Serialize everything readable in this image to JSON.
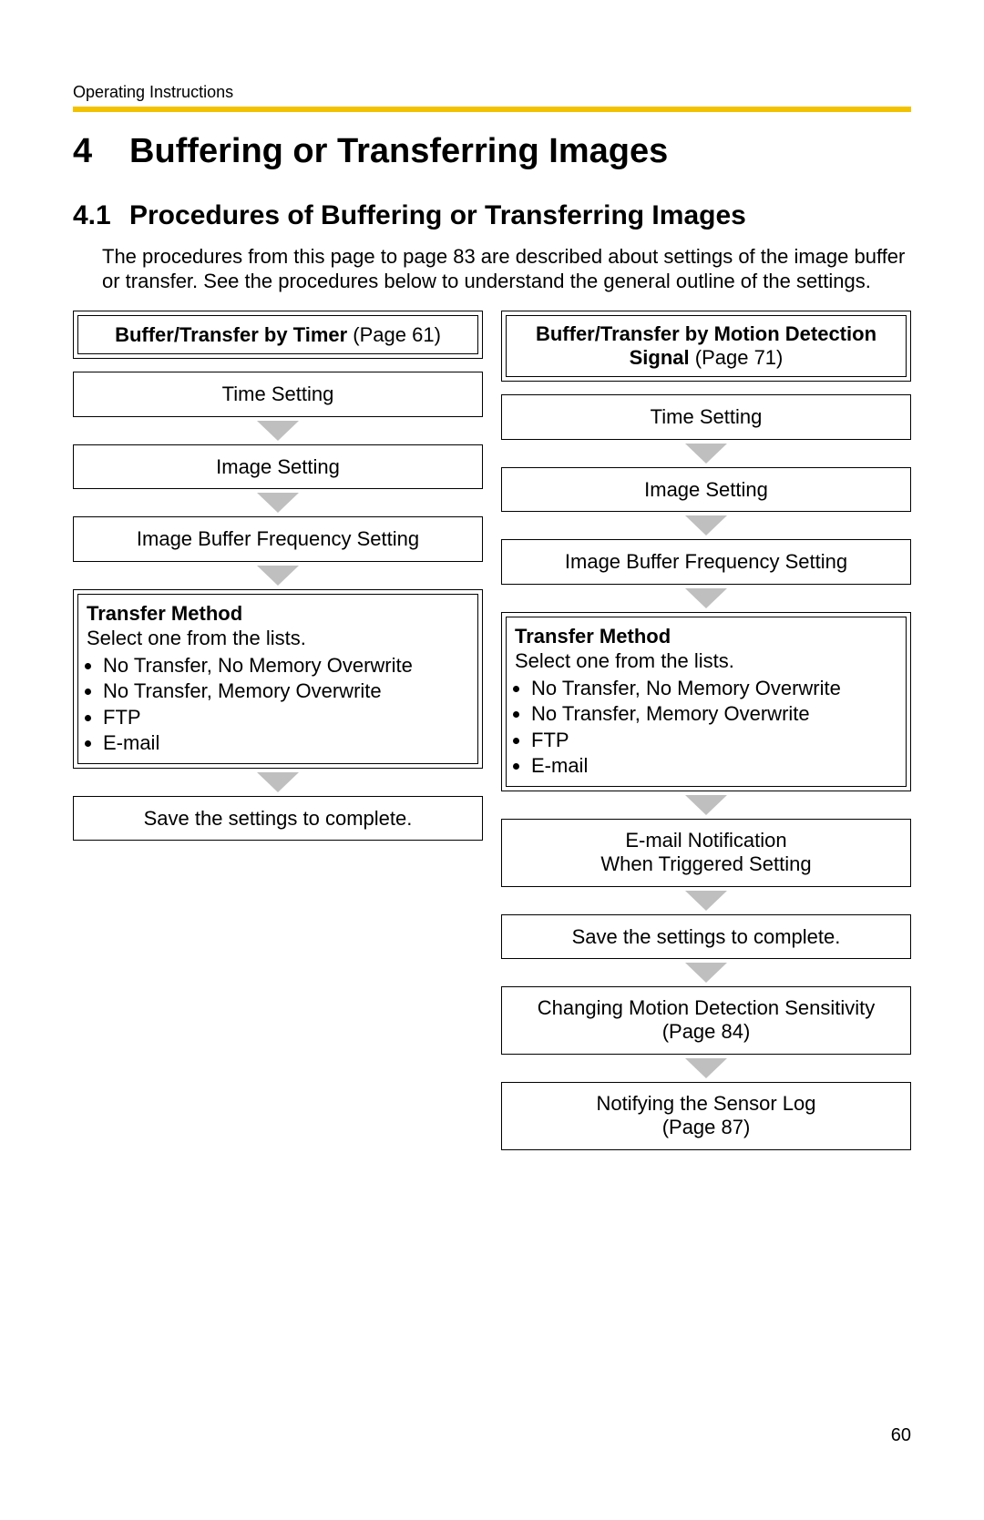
{
  "doc_header": "Operating Instructions",
  "section_number": "4",
  "section_title": "Buffering or Transferring Images",
  "subsection_number": "4.1",
  "subsection_title": "Procedures of Buffering or Transferring Images",
  "intro_text": "The procedures from this page to page 83 are described about settings of the image buffer or transfer. See the procedures below to understand the general outline of the settings.",
  "left_column": {
    "header_bold": "Buffer/Transfer by Timer",
    "header_page": " (Page 61)",
    "step1": "Time Setting",
    "step2": "Image Setting",
    "step3": "Image Buffer Frequency Setting",
    "transfer_method_title": "Transfer Method",
    "transfer_method_sub": "Select one from the lists.",
    "transfer_options": {
      "0": "No Transfer, No Memory Overwrite",
      "1": "No Transfer, Memory Overwrite",
      "2": "FTP",
      "3": "E-mail"
    },
    "step5": "Save the settings to complete."
  },
  "right_column": {
    "header_bold": "Buffer/Transfer by Motion Detection Signal",
    "header_page": " (Page 71)",
    "step1": "Time Setting",
    "step2": "Image Setting",
    "step3": "Image Buffer Frequency Setting",
    "transfer_method_title": "Transfer Method",
    "transfer_method_sub": "Select one from the lists.",
    "transfer_options": {
      "0": "No Transfer, No Memory Overwrite",
      "1": "No Transfer, Memory Overwrite",
      "2": "FTP",
      "3": "E-mail"
    },
    "step5_line1": "E-mail Notification",
    "step5_line2": "When Triggered Setting",
    "step6": "Save the settings to complete.",
    "step7_line1": "Changing Motion Detection Sensitivity",
    "step7_line2": "(Page 84)",
    "step8_line1": "Notifying the Sensor Log",
    "step8_line2": "(Page 87)"
  },
  "page_number": "60"
}
